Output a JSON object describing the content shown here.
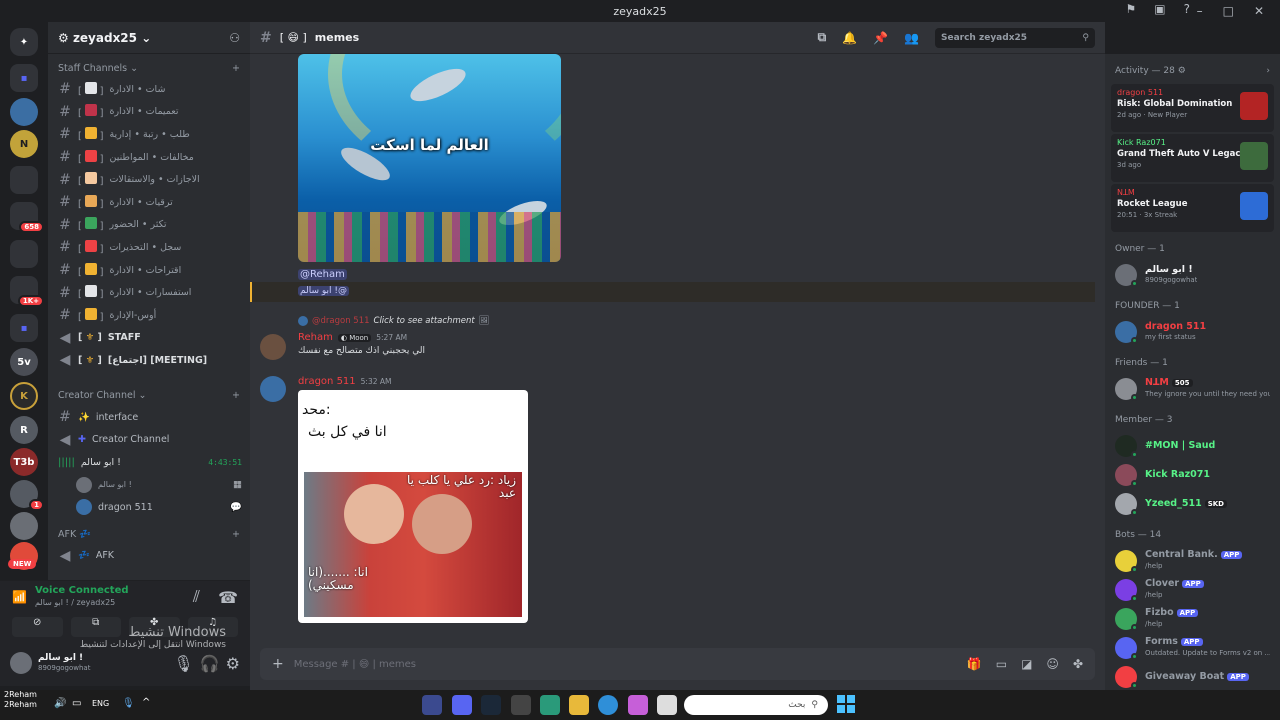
{
  "window": {
    "title": "zeyadx25"
  },
  "server": {
    "name": "zeyadx25"
  },
  "guild_badges": {
    "badge1": "658",
    "badge2": "1K+",
    "badge3": "1",
    "new": "NEW"
  },
  "categories": {
    "staff": "Staff Channels",
    "creator": "Creator Channel",
    "afk": "AFK"
  },
  "staff_channels": [
    {
      "label": "شات • الادارة",
      "color": "#e3e5e8"
    },
    {
      "label": "تعميمات • الادارة",
      "color": "#c0334a"
    },
    {
      "label": "طلب • رتبة • إدارية",
      "color": "#f0b232"
    },
    {
      "label": "مخالفات • المواطنين",
      "color": "#ed4245"
    },
    {
      "label": "الاجازات • والاستقالات",
      "color": "#f5c9a0"
    },
    {
      "label": "ترقيات • الادارة",
      "color": "#e8a857"
    },
    {
      "label": "تكثر • الحضور",
      "color": "#3ba55d"
    },
    {
      "label": "سجل • التحذيرات",
      "color": "#ed4245"
    },
    {
      "label": "اقتراحات • الادارة",
      "color": "#f0b232"
    },
    {
      "label": "استفسارات • الادارة",
      "color": "#e3e5e8"
    },
    {
      "label": "أوس-الإدارة",
      "color": "#f0b232"
    }
  ],
  "voice_staff": [
    {
      "label": "STAFF"
    },
    {
      "label": "[اجتماع] [MEETING]"
    }
  ],
  "creator_channels": {
    "interface": "interface",
    "creator": "Creator Channel",
    "voice_name": "ابو سالم !",
    "timer": "4:43:51",
    "users": [
      "ابو سالم !",
      "dragon 511"
    ]
  },
  "afk_channel": "AFK",
  "voice_connected": {
    "title": "Voice Connected",
    "sub": "ابو سالم ! / zeyadx25"
  },
  "user": {
    "name": "ابو سالم !",
    "tag": "8909gogowhat"
  },
  "windows_watermark": {
    "line1": "تنشيط Windows",
    "line2": "انتقل إلى الإعدادات لتنشيط Windows"
  },
  "channel": {
    "name": "memes",
    "prefix": "[ 😄 ]"
  },
  "search_placeholder": "Search zeyadx25",
  "messages": {
    "img1_caption": "العالم لما اسكت",
    "mention": "@Reham",
    "reply_text": "ابو سالم !@",
    "reply_ref_user": "@dragon 511",
    "reply_ref_text": "Click to see attachment",
    "m2_user": "Reham",
    "m2_tag": "Moon",
    "m2_time": "5:27 AM",
    "m2_text": "الي يحجبني اذك متصالح مع نفسك",
    "m3_user": "dragon 511",
    "m3_time": "5:32 AM",
    "meme_line1": "محد:",
    "meme_line2": "انا في كل بث",
    "meme_top": "زياد :رد علي يا كلب  يا عبد",
    "meme_bottom": "انا: .......(انا مسكيني)"
  },
  "composer": {
    "placeholder": "Message # | 😄 | memes"
  },
  "activity": {
    "header": "Activity — 28",
    "cards": [
      {
        "user": "dragon 511",
        "game": "Risk: Global Domination",
        "sub": "2d ago  ·  New Player",
        "color": "#f23f43",
        "art": "#b32424"
      },
      {
        "user": "Kick Raz071",
        "game": "Grand Theft Auto V Legacy",
        "sub": "3d ago",
        "color": "#57f287",
        "art": "#3d6b3d"
      },
      {
        "user": "ꓠꓕꓟ",
        "game": "Rocket League",
        "sub": "20:51  ·  3x Streak",
        "color": "#f23f43",
        "art": "#2d6cd6"
      }
    ]
  },
  "member_sections": {
    "owner": "Owner — 1",
    "founder": "FOUNDER — 1",
    "friends": "Friends — 1",
    "member": "Member — 3",
    "bots": "Bots — 14"
  },
  "members": {
    "owner": [
      {
        "name": "ابو سالم !",
        "sub": "8909gogowhat",
        "color": "#f2f3f5",
        "av": "#6b6f77"
      }
    ],
    "founder": [
      {
        "name": "dragon 511",
        "sub": "my first status",
        "color": "#f23f43",
        "av": "#3a6ea5"
      }
    ],
    "friends": [
      {
        "name": "ꓠꓕꓟ",
        "tag": "505",
        "sub": "They ignore you until they need you",
        "color": "#f23f43",
        "av": "#8a8d93"
      }
    ],
    "member": [
      {
        "name": "#MON | Saud",
        "tag": "",
        "color": "#57f287",
        "av": "#1f2a22"
      },
      {
        "name": "Kick Raz071",
        "color": "#57f287",
        "av": "#8b4a5a"
      },
      {
        "name": "Yzeed_511",
        "tag": "SKD",
        "color": "#57f287",
        "av": "#a3a7ad"
      }
    ],
    "bots": [
      {
        "name": "Central Bank.",
        "sub": "/help",
        "color": "#949ba4",
        "av": "#e8d03a"
      },
      {
        "name": "Clover",
        "sub": "/help",
        "color": "#949ba4",
        "av": "#7b3fe4"
      },
      {
        "name": "Fizbo",
        "sub": "/help",
        "color": "#949ba4",
        "av": "#3aa55d"
      },
      {
        "name": "Forms",
        "sub": "Outdated. Update to Forms v2 on ...",
        "color": "#949ba4",
        "av": "#5865f2"
      },
      {
        "name": "Giveaway Boat",
        "sub": "",
        "color": "#949ba4",
        "av": "#f23f43"
      }
    ],
    "app_label": "APP"
  },
  "taskbar": {
    "search_placeholder": "بحث",
    "lang": "ENG",
    "user_l1": "2Reham",
    "user_l2": "2Reham"
  }
}
